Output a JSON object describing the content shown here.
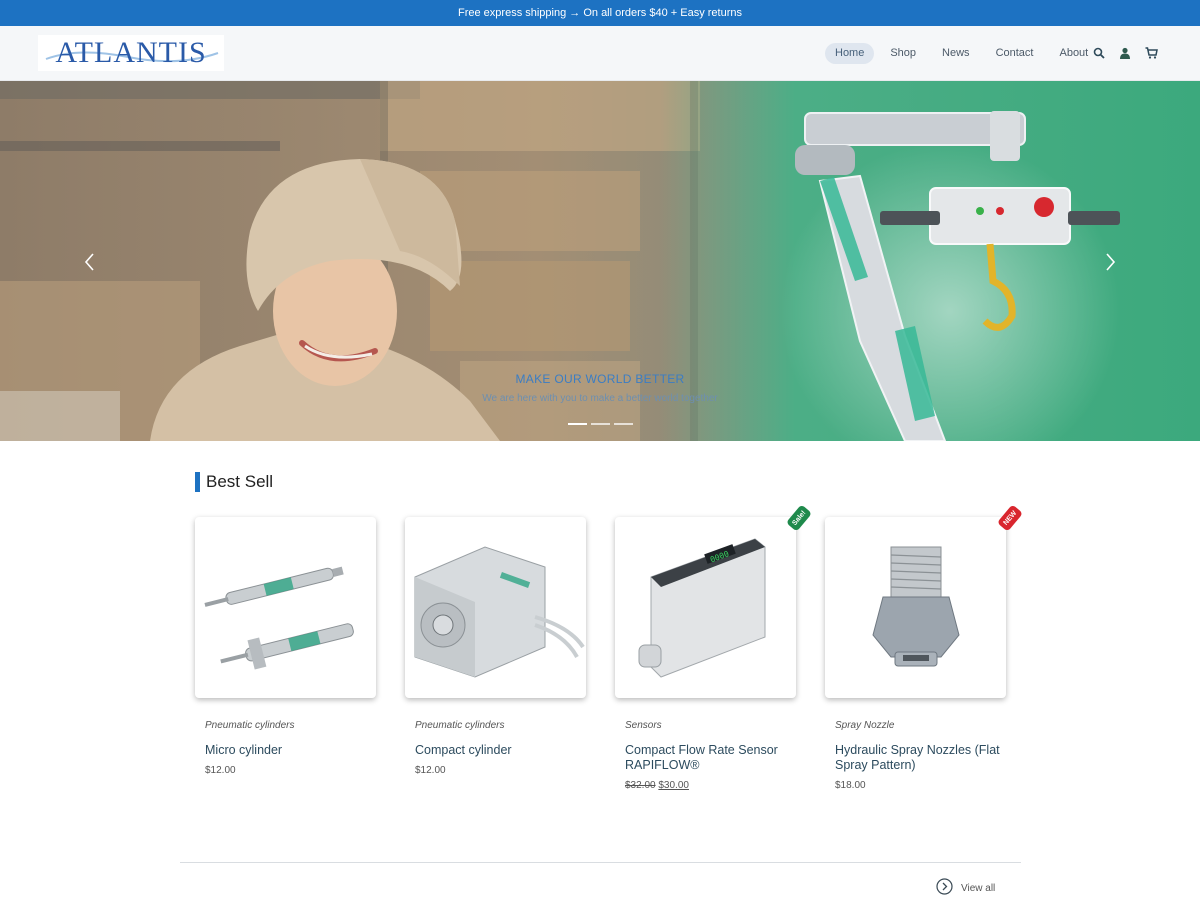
{
  "announcement": "Free express shipping → On all orders $40 + Easy returns",
  "logo_text": "ATLANTIS",
  "nav": {
    "items": [
      "Home",
      "Shop",
      "News",
      "Contact",
      "About"
    ],
    "icons": [
      "search-icon",
      "user-icon",
      "cart-icon"
    ]
  },
  "hero": {
    "title": "MAKE OUR WORLD BETTER",
    "subtitle": "We are here with you to make a better world together",
    "slides": 3,
    "active_slide": 1,
    "prev_icon": "chevron-left-icon",
    "next_icon": "chevron-right-icon"
  },
  "best_sell": {
    "title": "Best Sell",
    "products": [
      {
        "category": "Pneumatic cylinders",
        "name": "Micro cylinder",
        "price": "$12.00"
      },
      {
        "category": "Pneumatic cylinders",
        "name": "Compact cylinder",
        "price": "$12.00"
      },
      {
        "category": "Sensors",
        "name": "Compact Flow Rate Sensor RAPIFLOW®",
        "old_price": "$32.00",
        "price": "$30.00",
        "badge": "Sale!"
      },
      {
        "category": "Spray Nozzle",
        "name": "Hydraulic Spray Nozzles (Flat Spray Pattern)",
        "price": "$18.00",
        "badge": "NEW"
      }
    ]
  },
  "view_all": "View all",
  "colors": {
    "accent": "#1d72c2",
    "hero_green": "#3dab7e",
    "sale": "#1f8a4c",
    "new": "#d9262e"
  }
}
